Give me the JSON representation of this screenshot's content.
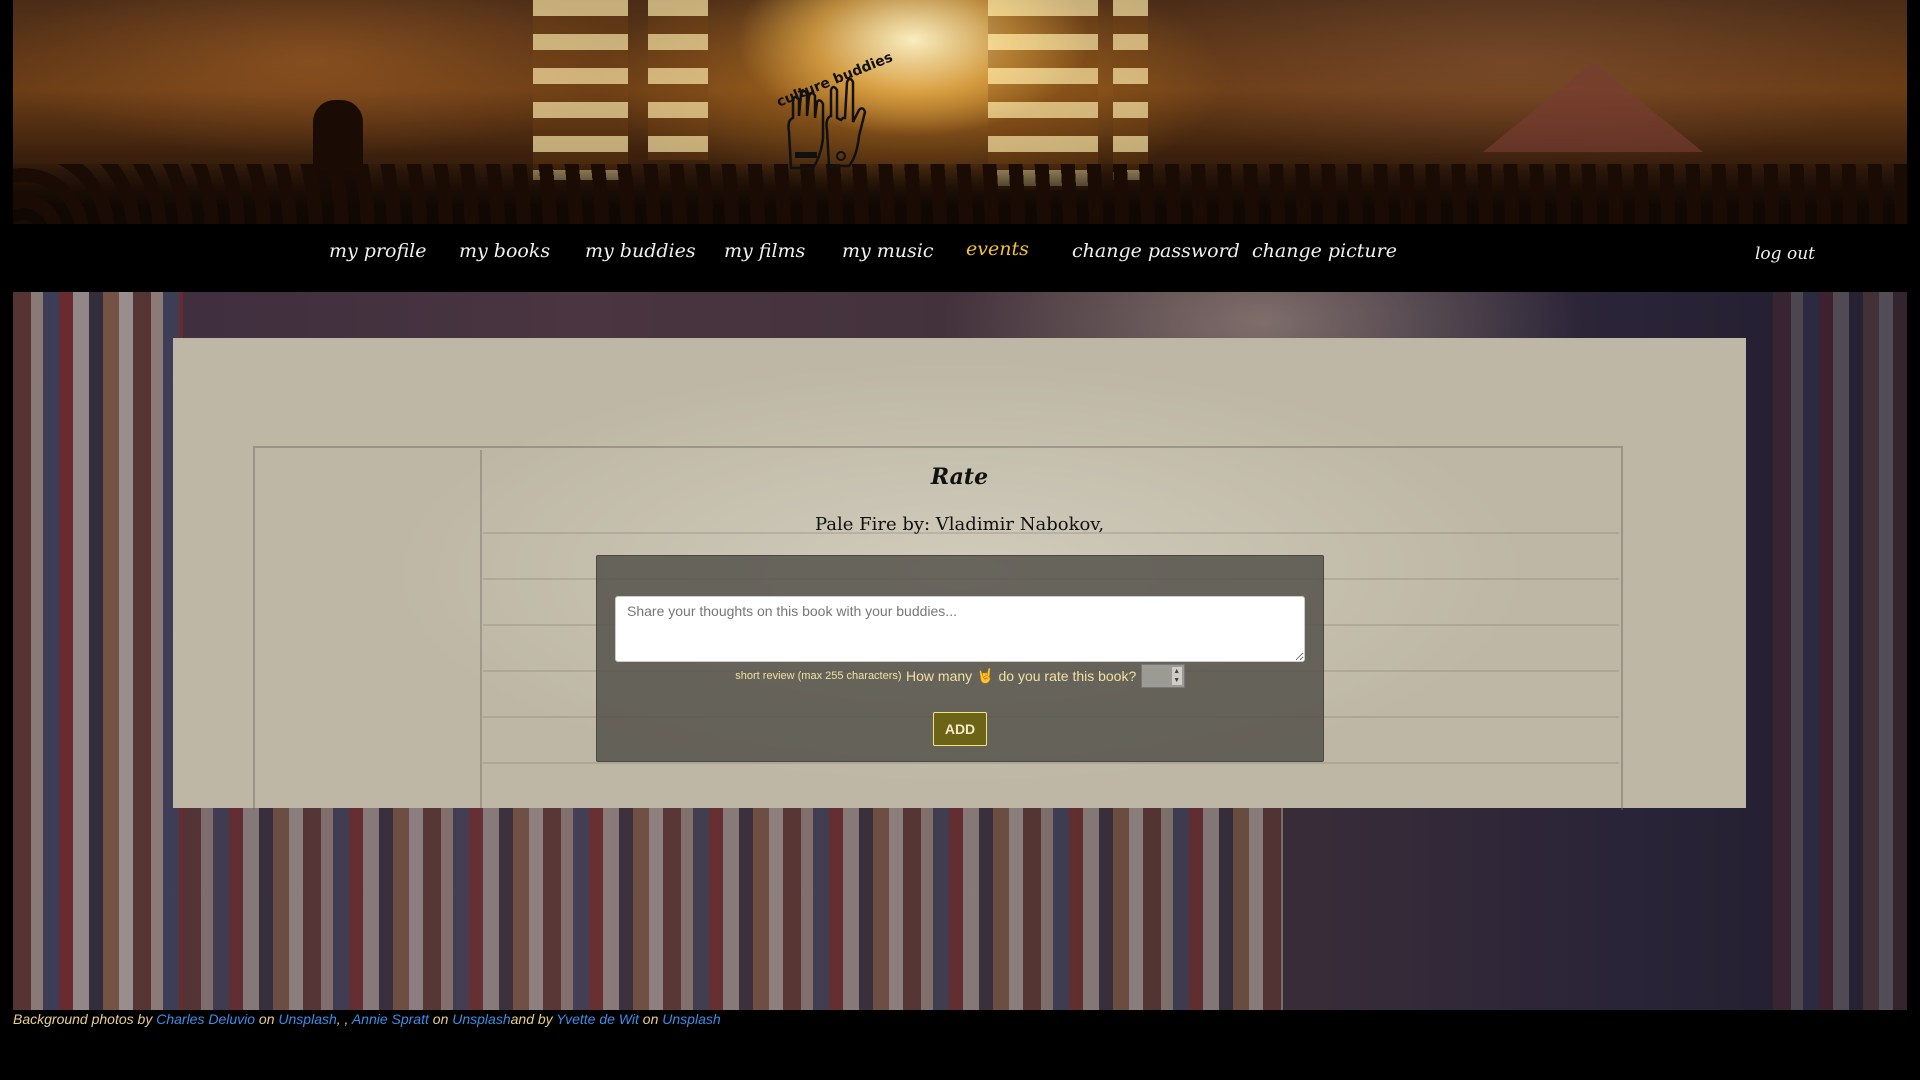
{
  "brand": {
    "logo_text": "culture buddies"
  },
  "nav": {
    "items": [
      {
        "label": "my profile"
      },
      {
        "label": "my books"
      },
      {
        "label": "my buddies"
      },
      {
        "label": "my films"
      },
      {
        "label": "my music"
      },
      {
        "label": "events",
        "active": true
      },
      {
        "label": "change password"
      },
      {
        "label": "change picture"
      }
    ],
    "logout": "log out"
  },
  "main": {
    "title": "Rate",
    "book_line": "Pale Fire by: Vladimir Nabokov,",
    "review": {
      "placeholder": "Share your thoughts on this book with your buddies...",
      "value": "",
      "hint": "short review (max 255 characters)"
    },
    "rating": {
      "question_before": "How many",
      "icon": "rock-on-hand-icon",
      "icon_glyph": "🤘",
      "question_after": "do you rate this book?",
      "value": ""
    },
    "add_label": "ADD"
  },
  "footer": {
    "prefix": "Background photos by ",
    "photographer1": "Charles Deluvio",
    "on1": " on ",
    "site1": "Unsplash",
    "sep": ", , ",
    "photographer2": "Annie Spratt",
    "on2": " on ",
    "site2": "Unsplash",
    "and_by": "and by ",
    "photographer3": "Yvette de Wit",
    "on3": " on ",
    "site3": "Unsplash"
  },
  "colors": {
    "nav_active": "#f2c335",
    "link": "#3b8ee8",
    "button_bg": "#6b6316",
    "credit_text": "#e8cf8e"
  }
}
